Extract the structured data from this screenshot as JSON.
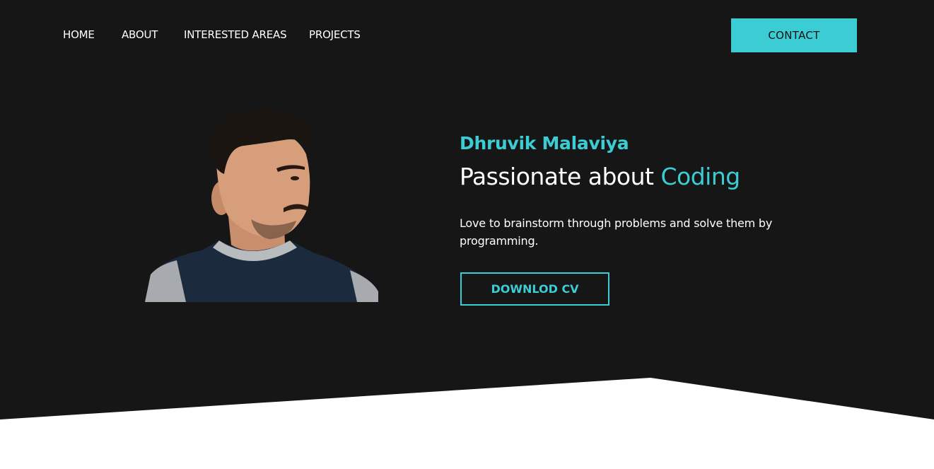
{
  "nav": {
    "items": [
      {
        "label": "HOME"
      },
      {
        "label": "ABOUT"
      },
      {
        "label": "INTERESTED AREAS"
      },
      {
        "label": "PROJECTS"
      }
    ],
    "contact_label": "CONTACT"
  },
  "hero": {
    "name": "Dhruvik Malaviya",
    "title_prefix": "Passionate about ",
    "title_highlight": "Coding",
    "description": "Love to brainstorm through problems and solve them by programming.",
    "cv_button_label": "DOWNLOD CV"
  },
  "colors": {
    "background": "#161616",
    "accent": "#3ccdd4",
    "text": "#ffffff",
    "section_below": "#ffffff"
  }
}
